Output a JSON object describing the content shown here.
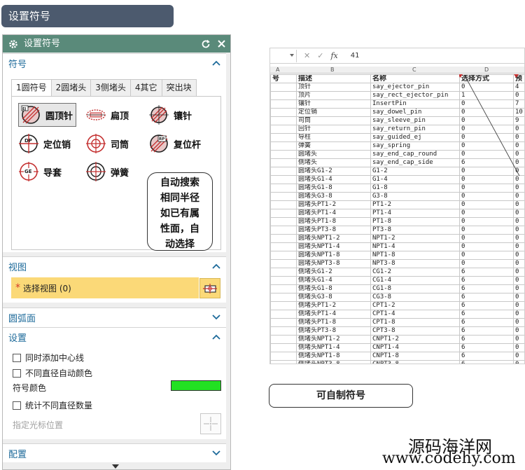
{
  "banner": {
    "title": "设置符号"
  },
  "dialog": {
    "title": "设置符号",
    "sections": {
      "symbol": "符号",
      "view": "视图",
      "arc": "圆弧面",
      "settings": "设置",
      "config": "配置"
    },
    "tabs": [
      "1圆符号",
      "2圆堵头",
      "3侧堵头",
      "4其它",
      "突出块"
    ],
    "active_tab": "1圆符号",
    "symbols": [
      {
        "label": "圆顶针",
        "icon": "ejector-pin-icon",
        "selected": true
      },
      {
        "label": "扁顶",
        "icon": "flat-ejector-icon"
      },
      {
        "label": "镶针",
        "icon": "insert-pin-icon"
      },
      {
        "label": "定位销",
        "icon": "dowel-pin-icon"
      },
      {
        "label": "司筒",
        "icon": "sleeve-pin-icon"
      },
      {
        "label": "复位杆",
        "icon": "return-pin-icon"
      },
      {
        "label": "导套",
        "icon": "guided-ej-icon"
      },
      {
        "label": "弹簧",
        "icon": "spring-icon"
      }
    ],
    "callout_lines": [
      "自动搜索",
      "相同半径",
      "如已有属",
      "性面，自",
      "动选择"
    ],
    "select_view": {
      "star": "*",
      "label": "选择视图 (0)"
    },
    "checkboxes": {
      "add_centerline": "同时添加中心线",
      "auto_color": "不同直径自动颜色",
      "count": "统计不同直径数量"
    },
    "symbol_color_label": "符号颜色",
    "symbol_color": "#22e022",
    "cursor_label": "指定光标位置"
  },
  "sheet": {
    "formula_value": "41",
    "column_letters": [
      "A",
      "B",
      "C",
      "D"
    ],
    "header": [
      "号",
      "描述",
      "名称",
      "选择方式",
      "预"
    ],
    "rows": [
      [
        "顶针",
        "say_ejector_pin",
        "0",
        "4"
      ],
      [
        "顶片",
        "say_rect_ejector_pin",
        "1",
        "0"
      ],
      [
        "镶针",
        "InsertPin",
        "0",
        "7"
      ],
      [
        "定位销",
        "say_dowel_pin",
        "0",
        "10"
      ],
      [
        "司筒",
        "say_sleeve_pin",
        "0",
        "9"
      ],
      [
        "回针",
        "say_return_pin",
        "0",
        "0"
      ],
      [
        "导柱",
        "say_guided_ej",
        "0",
        "0"
      ],
      [
        "弹簧",
        "say_spring",
        "0",
        "0"
      ],
      [
        "圆堵头",
        "say_end_cap_round",
        "0",
        "0"
      ],
      [
        "侧堵头",
        "say_end_cap_side",
        "6",
        "0"
      ],
      [
        "圆堵头G1-2",
        "G1-2",
        "0",
        "0"
      ],
      [
        "圆堵头G1-4",
        "G1-4",
        "0",
        "0"
      ],
      [
        "圆堵头G1-8",
        "G1-8",
        "0",
        "0"
      ],
      [
        "圆堵头G3-8",
        "G3-8",
        "0",
        "0"
      ],
      [
        "圆堵头PT1-2",
        "PT1-2",
        "0",
        "0"
      ],
      [
        "圆堵头PT1-4",
        "PT1-4",
        "0",
        "0"
      ],
      [
        "圆堵头PT1-8",
        "PT1-8",
        "0",
        "0"
      ],
      [
        "圆堵头PT3-8",
        "PT3-8",
        "0",
        "0"
      ],
      [
        "圆堵头NPT1-2",
        "NPT1-2",
        "0",
        "0"
      ],
      [
        "圆堵头NPT1-4",
        "NPT1-4",
        "0",
        "0"
      ],
      [
        "圆堵头NPT1-8",
        "NPT1-8",
        "0",
        "0"
      ],
      [
        "圆堵头NPT3-8",
        "NPT3-8",
        "0",
        "0"
      ],
      [
        "侧堵头G1-2",
        "CG1-2",
        "6",
        "0"
      ],
      [
        "侧堵头G1-4",
        "CG1-4",
        "6",
        "0"
      ],
      [
        "侧堵头G1-8",
        "CG1-8",
        "6",
        "0"
      ],
      [
        "侧堵头G3-8",
        "CG3-8",
        "6",
        "0"
      ],
      [
        "侧堵头PT1-2",
        "CPT1-2",
        "6",
        "0"
      ],
      [
        "侧堵头PT1-4",
        "CPT1-4",
        "6",
        "0"
      ],
      [
        "侧堵头PT1-8",
        "CPT1-8",
        "6",
        "0"
      ],
      [
        "侧堵头PT3-8",
        "CPT3-8",
        "6",
        "0"
      ],
      [
        "侧堵头NPT1-2",
        "CNPT1-2",
        "6",
        "0"
      ],
      [
        "侧堵头NPT1-4",
        "CNPT1-4",
        "6",
        "0"
      ],
      [
        "侧堵头NPT1-8",
        "CNPT1-8",
        "6",
        "0"
      ],
      [
        "侧堵头NPT3-8",
        "CNPT3-8",
        "6",
        "0"
      ]
    ]
  },
  "note": "可自制符号",
  "watermark": {
    "line1": "源码海洋网",
    "line2": "www.codehy.com"
  }
}
